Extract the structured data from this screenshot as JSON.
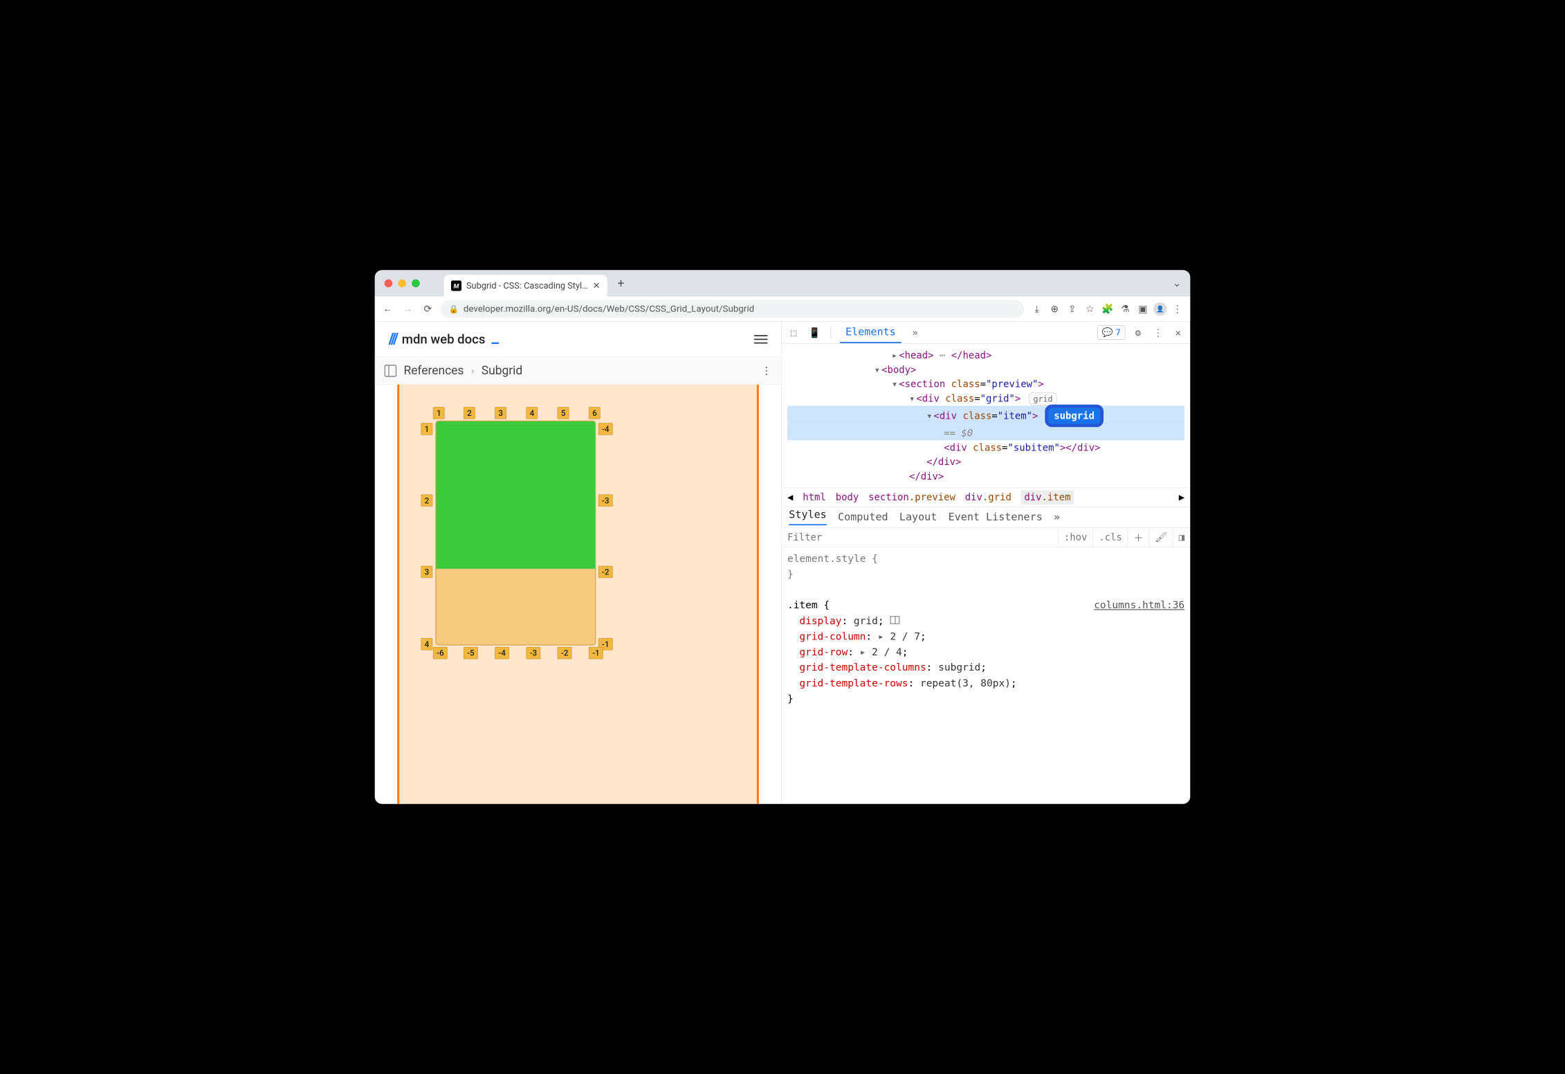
{
  "browser": {
    "tab_title": "Subgrid - CSS: Cascading Styl…",
    "url": "developer.mozilla.org/en-US/docs/Web/CSS/CSS_Grid_Layout/Subgrid"
  },
  "page": {
    "logo_text": "mdn web docs",
    "breadcrumb": {
      "root": "References",
      "current": "Subgrid"
    },
    "grid_labels": {
      "top": [
        "1",
        "2",
        "3",
        "4",
        "5",
        "6"
      ],
      "left": [
        "1",
        "2",
        "3",
        "4"
      ],
      "right": [
        "-4",
        "-3",
        "-2",
        "-1"
      ],
      "bottom": [
        "-6",
        "-5",
        "-4",
        "-3",
        "-2",
        "-1"
      ]
    }
  },
  "devtools": {
    "tab_active": "Elements",
    "issues_count": "7",
    "dom": {
      "head": "<head>…</head>",
      "body_open": "<body>",
      "section_open": "<section class=\"preview\">",
      "grid_open": "<div class=\"grid\">",
      "grid_badge": "grid",
      "item_open": "<div class=\"item\">",
      "item_badge": "subgrid",
      "eq": "== $0",
      "subitem": "<div class=\"subitem\"></div>",
      "div_close": "</div>",
      "div_close2": "</div>"
    },
    "path": {
      "html": "html",
      "body": "body",
      "section": "section",
      "section_cls": ".preview",
      "div1": "div",
      "div1_cls": ".grid",
      "div2": "div",
      "div2_cls": ".item"
    },
    "styles_tabs": {
      "styles": "Styles",
      "computed": "Computed",
      "layout": "Layout",
      "ev": "Event Listeners"
    },
    "filter": {
      "placeholder": "Filter",
      "hov": ":hov",
      "cls": ".cls"
    },
    "rules": {
      "elstyle": "element.style {",
      "close": "}",
      "item_sel": ".item {",
      "src": "columns.html:36",
      "p1": "display",
      "v1": "grid",
      "p2": "grid-column",
      "v2": "2 / 7",
      "p3": "grid-row",
      "v3": "2 / 4",
      "p4": "grid-template-columns",
      "v4": "subgrid",
      "p5": "grid-template-rows",
      "v5": "repeat(3, 80px)"
    }
  }
}
